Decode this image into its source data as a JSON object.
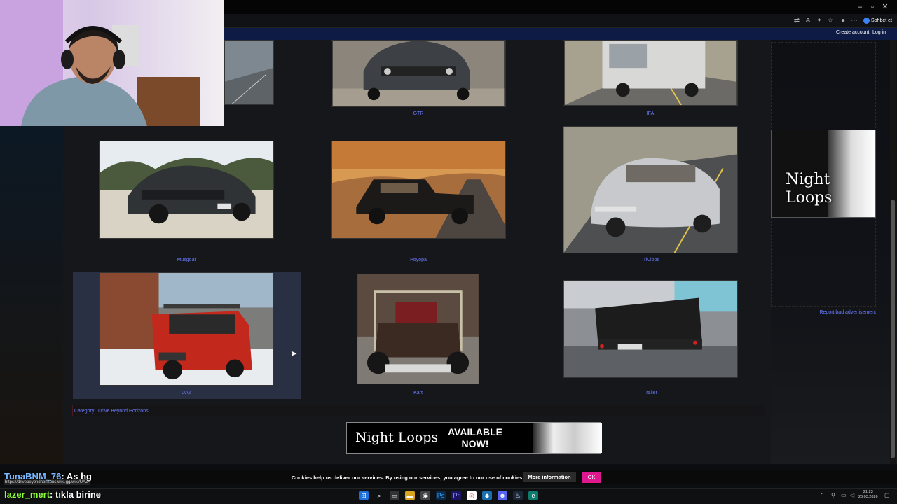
{
  "browser": {
    "chat_button_label": "Sohbet et",
    "wiki_links": {
      "create_account": "Create account",
      "log_in": "Log in"
    }
  },
  "gallery": {
    "items": [
      {
        "caption": "GTR"
      },
      {
        "caption": "IFA"
      },
      {
        "caption": "Musgoat"
      },
      {
        "caption": "Poyopa"
      },
      {
        "caption": "TriClops"
      },
      {
        "caption": "UAZ"
      },
      {
        "caption": "Kart"
      },
      {
        "caption": "Trailer"
      }
    ]
  },
  "category": {
    "label": "Category:",
    "value": "Drive Beyond Horizons"
  },
  "banner": {
    "title": "Night Loops",
    "subtitle_line1": "AVAILABLE",
    "subtitle_line2": "NOW!"
  },
  "side_ad": {
    "line1": "Night",
    "line2": "Loops",
    "report_link": "Report bad advertisement"
  },
  "cookie_bar": {
    "text": "Cookies help us deliver our services. By using our services, you agree to our use of cookies.",
    "more_info": "More information",
    "ok": "OK"
  },
  "status_url": "https://drivebeyondhorizons.wiki.gg/wiki/UAZ",
  "stream_chat": [
    {
      "user": "TunaBNM_76",
      "message": ": As hg"
    },
    {
      "user": "lazer_mert",
      "message": ": tıkla birine"
    }
  ],
  "clock": {
    "time": "21:23",
    "date": "28.03.2026"
  },
  "colors": {
    "link": "#6b7cff",
    "ok_button": "#e0188f",
    "wiki_header": "#0d1b45"
  }
}
